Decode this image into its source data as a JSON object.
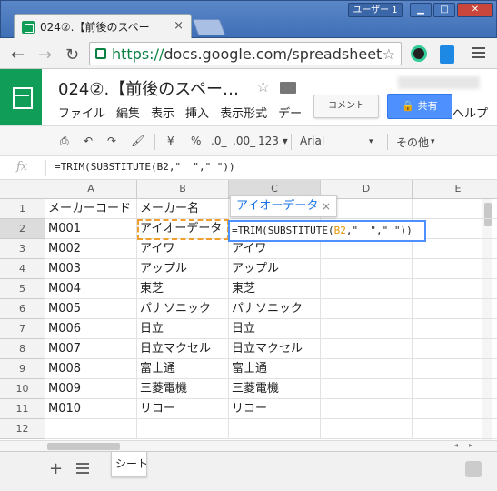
{
  "browser": {
    "tab_title": "024②.【前後のスペー",
    "tab_close": "×",
    "user_label": "ユーザー 1",
    "url_https": "https://",
    "url_rest": "docs.google.com/spreadsheet",
    "min_btn": "▁",
    "max_btn": "□",
    "close_btn": "✕"
  },
  "docs": {
    "title": "024②.【前後のスペー…",
    "menus": [
      "ファイル",
      "編集",
      "表示",
      "挿入",
      "表示形式",
      "デー",
      "",
      "ヘルプ"
    ],
    "comment_label": "コメント",
    "share_label": "共有"
  },
  "toolbar": {
    "currency": "¥",
    "percent": "%",
    "dec_less": ".0_",
    "dec_more": ".00_",
    "number_format": "123 ▾",
    "font": "Arial",
    "more": "その他"
  },
  "formula_bar": {
    "fx": "fx",
    "text": "=TRIM(SUBSTITUTE(B2,\"  \",\" \"))"
  },
  "grid": {
    "columns": [
      "A",
      "B",
      "C",
      "D",
      "E"
    ],
    "rows": [
      "1",
      "2",
      "3",
      "4",
      "5",
      "6",
      "7",
      "8",
      "9",
      "10",
      "11",
      "12"
    ],
    "cells": [
      [
        "メーカーコード",
        "メーカー名",
        "",
        "",
        ""
      ],
      [
        "M001",
        "アイオーデータ",
        "",
        "",
        ""
      ],
      [
        "M002",
        "アイワ",
        "アイワ",
        "",
        ""
      ],
      [
        "M003",
        "アップル",
        "アップル",
        "",
        ""
      ],
      [
        "M004",
        "東芝",
        "東芝",
        "",
        ""
      ],
      [
        "M005",
        "パナソニック",
        "パナソニック",
        "",
        ""
      ],
      [
        "M006",
        "日立",
        "日立",
        "",
        ""
      ],
      [
        "M007",
        "日立マクセル",
        "日立マクセル",
        "",
        ""
      ],
      [
        "M008",
        "富士通",
        "富士通",
        "",
        ""
      ],
      [
        "M009",
        "三菱電機",
        "三菱電機",
        "",
        ""
      ],
      [
        "M010",
        "リコー",
        "リコー",
        "",
        ""
      ],
      [
        "",
        "",
        "",
        "",
        ""
      ]
    ],
    "editor": {
      "prefix": "=TRIM(SUBSTITUTE(",
      "ref": "B2",
      "suffix": ",\"  \",\" \"))"
    },
    "hint": "アイオーデータ",
    "hint_close": "×"
  },
  "sheets": {
    "add": "+",
    "active_tab": "シート"
  }
}
